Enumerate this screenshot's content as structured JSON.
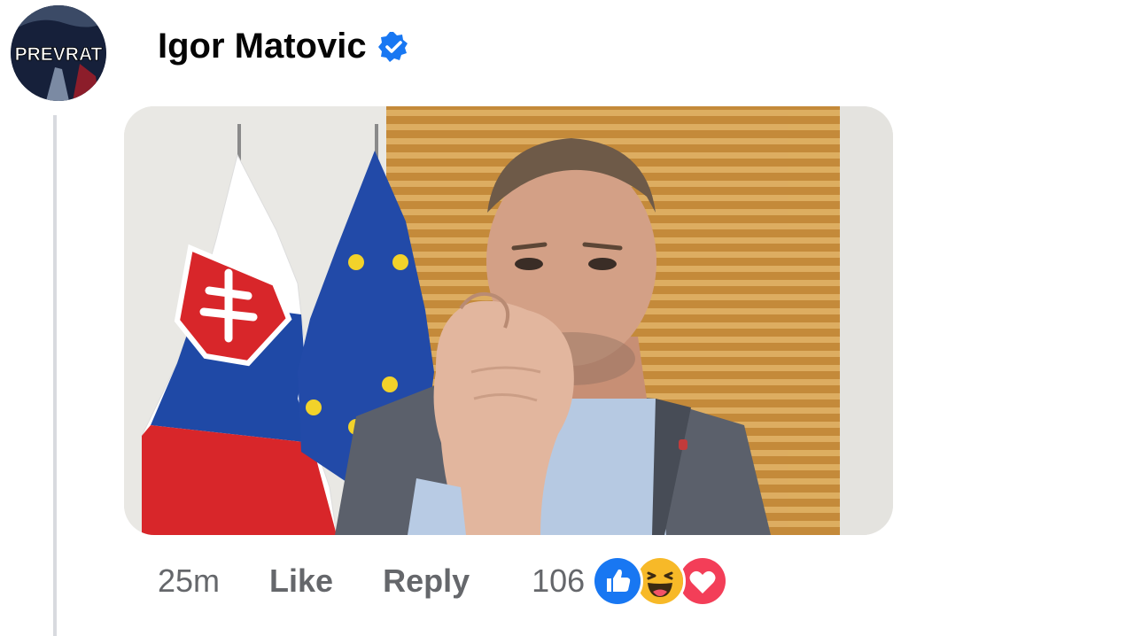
{
  "comment": {
    "author": {
      "name": "Igor Matovic",
      "verified": true,
      "avatar_text": "PREVRAT"
    },
    "media": {
      "type": "video-thumbnail"
    },
    "actions": {
      "timestamp": "25m",
      "like_label": "Like",
      "reply_label": "Reply"
    },
    "reactions": {
      "count": "106",
      "types": [
        "like-icon",
        "haha-icon",
        "love-icon"
      ]
    }
  },
  "colors": {
    "verified_blue": "#1877f2",
    "like_blue": "#1877f2",
    "haha_yellow": "#f7b928",
    "love_red": "#f33e58",
    "secondary_text": "#65676b",
    "thread_line": "#d8dadf"
  }
}
